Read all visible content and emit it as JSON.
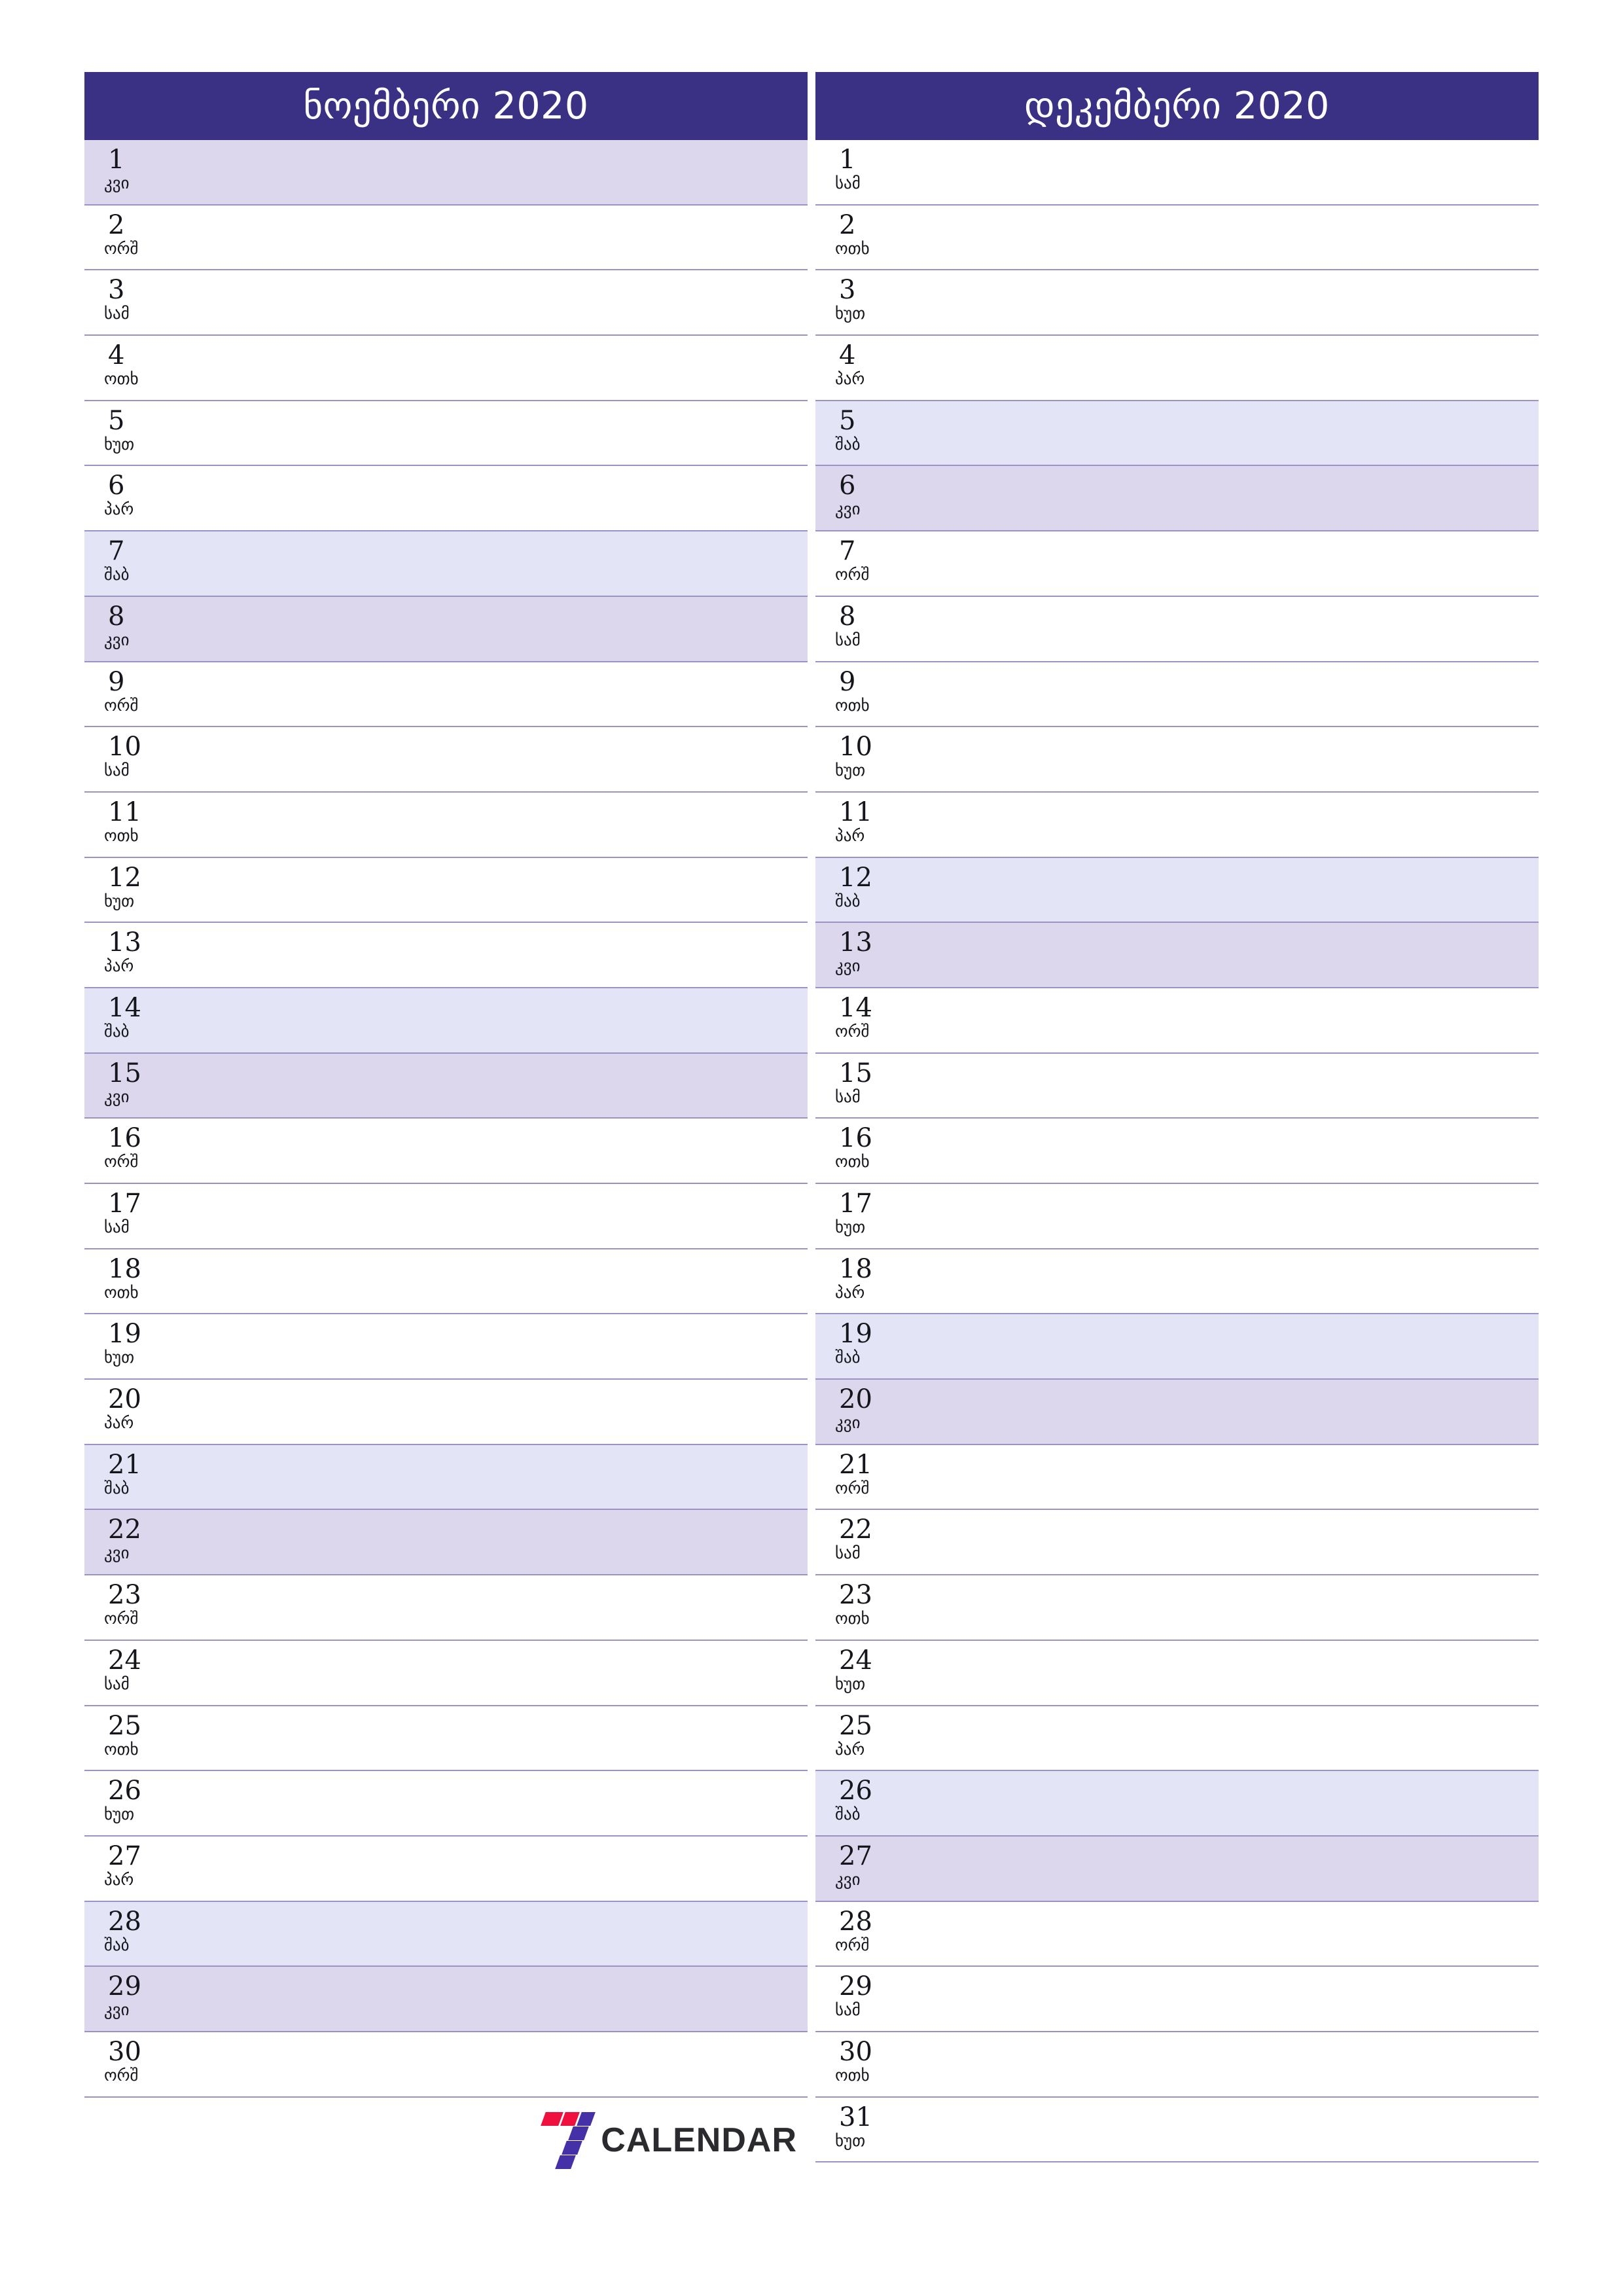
{
  "document": {
    "type": "monthly-planner",
    "year": "2020",
    "language": "ka"
  },
  "colors": {
    "header_bg": "#3b3184",
    "header_text": "#ffffff",
    "saturday_bg": "#e4e4f7",
    "sunday_bg": "#dcd7ec",
    "row_divider": "#9a93c4",
    "day_text": "#15161c",
    "logo_red": "#f01040",
    "logo_purple": "#4530a8",
    "logo_text": "#2b2b2f"
  },
  "weekdays": {
    "sun": "კვი",
    "mon": "ორშ",
    "tue": "სამ",
    "wed": "ოთხ",
    "thu": "ხუთ",
    "fri": "პარ",
    "sat": "შაბ"
  },
  "months": [
    {
      "title": "ნოემბერი 2020",
      "name": "ნოემბერი",
      "year": "2020",
      "days": [
        {
          "num": "1",
          "wd": "კვი",
          "type": "sun"
        },
        {
          "num": "2",
          "wd": "ორშ",
          "type": ""
        },
        {
          "num": "3",
          "wd": "სამ",
          "type": ""
        },
        {
          "num": "4",
          "wd": "ოთხ",
          "type": ""
        },
        {
          "num": "5",
          "wd": "ხუთ",
          "type": ""
        },
        {
          "num": "6",
          "wd": "პარ",
          "type": ""
        },
        {
          "num": "7",
          "wd": "შაბ",
          "type": "sat"
        },
        {
          "num": "8",
          "wd": "კვი",
          "type": "sun"
        },
        {
          "num": "9",
          "wd": "ორშ",
          "type": ""
        },
        {
          "num": "10",
          "wd": "სამ",
          "type": ""
        },
        {
          "num": "11",
          "wd": "ოთხ",
          "type": ""
        },
        {
          "num": "12",
          "wd": "ხუთ",
          "type": ""
        },
        {
          "num": "13",
          "wd": "პარ",
          "type": ""
        },
        {
          "num": "14",
          "wd": "შაბ",
          "type": "sat"
        },
        {
          "num": "15",
          "wd": "კვი",
          "type": "sun"
        },
        {
          "num": "16",
          "wd": "ორშ",
          "type": ""
        },
        {
          "num": "17",
          "wd": "სამ",
          "type": ""
        },
        {
          "num": "18",
          "wd": "ოთხ",
          "type": ""
        },
        {
          "num": "19",
          "wd": "ხუთ",
          "type": ""
        },
        {
          "num": "20",
          "wd": "პარ",
          "type": ""
        },
        {
          "num": "21",
          "wd": "შაბ",
          "type": "sat"
        },
        {
          "num": "22",
          "wd": "კვი",
          "type": "sun"
        },
        {
          "num": "23",
          "wd": "ორშ",
          "type": ""
        },
        {
          "num": "24",
          "wd": "სამ",
          "type": ""
        },
        {
          "num": "25",
          "wd": "ოთხ",
          "type": ""
        },
        {
          "num": "26",
          "wd": "ხუთ",
          "type": ""
        },
        {
          "num": "27",
          "wd": "პარ",
          "type": ""
        },
        {
          "num": "28",
          "wd": "შაბ",
          "type": "sat"
        },
        {
          "num": "29",
          "wd": "კვი",
          "type": "sun"
        },
        {
          "num": "30",
          "wd": "ორშ",
          "type": ""
        }
      ]
    },
    {
      "title": "დეკემბერი 2020",
      "name": "დეკემბერი",
      "year": "2020",
      "days": [
        {
          "num": "1",
          "wd": "სამ",
          "type": ""
        },
        {
          "num": "2",
          "wd": "ოთხ",
          "type": ""
        },
        {
          "num": "3",
          "wd": "ხუთ",
          "type": ""
        },
        {
          "num": "4",
          "wd": "პარ",
          "type": ""
        },
        {
          "num": "5",
          "wd": "შაბ",
          "type": "sat"
        },
        {
          "num": "6",
          "wd": "კვი",
          "type": "sun"
        },
        {
          "num": "7",
          "wd": "ორშ",
          "type": ""
        },
        {
          "num": "8",
          "wd": "სამ",
          "type": ""
        },
        {
          "num": "9",
          "wd": "ოთხ",
          "type": ""
        },
        {
          "num": "10",
          "wd": "ხუთ",
          "type": ""
        },
        {
          "num": "11",
          "wd": "პარ",
          "type": ""
        },
        {
          "num": "12",
          "wd": "შაბ",
          "type": "sat"
        },
        {
          "num": "13",
          "wd": "კვი",
          "type": "sun"
        },
        {
          "num": "14",
          "wd": "ორშ",
          "type": ""
        },
        {
          "num": "15",
          "wd": "სამ",
          "type": ""
        },
        {
          "num": "16",
          "wd": "ოთხ",
          "type": ""
        },
        {
          "num": "17",
          "wd": "ხუთ",
          "type": ""
        },
        {
          "num": "18",
          "wd": "პარ",
          "type": ""
        },
        {
          "num": "19",
          "wd": "შაბ",
          "type": "sat"
        },
        {
          "num": "20",
          "wd": "კვი",
          "type": "sun"
        },
        {
          "num": "21",
          "wd": "ორშ",
          "type": ""
        },
        {
          "num": "22",
          "wd": "სამ",
          "type": ""
        },
        {
          "num": "23",
          "wd": "ოთხ",
          "type": ""
        },
        {
          "num": "24",
          "wd": "ხუთ",
          "type": ""
        },
        {
          "num": "25",
          "wd": "პარ",
          "type": ""
        },
        {
          "num": "26",
          "wd": "შაბ",
          "type": "sat"
        },
        {
          "num": "27",
          "wd": "კვი",
          "type": "sun"
        },
        {
          "num": "28",
          "wd": "ორშ",
          "type": ""
        },
        {
          "num": "29",
          "wd": "სამ",
          "type": ""
        },
        {
          "num": "30",
          "wd": "ოთხ",
          "type": ""
        },
        {
          "num": "31",
          "wd": "ხუთ",
          "type": ""
        }
      ]
    }
  ],
  "logo": {
    "mark": "seven-logo-icon",
    "text": "CALENDAR"
  }
}
